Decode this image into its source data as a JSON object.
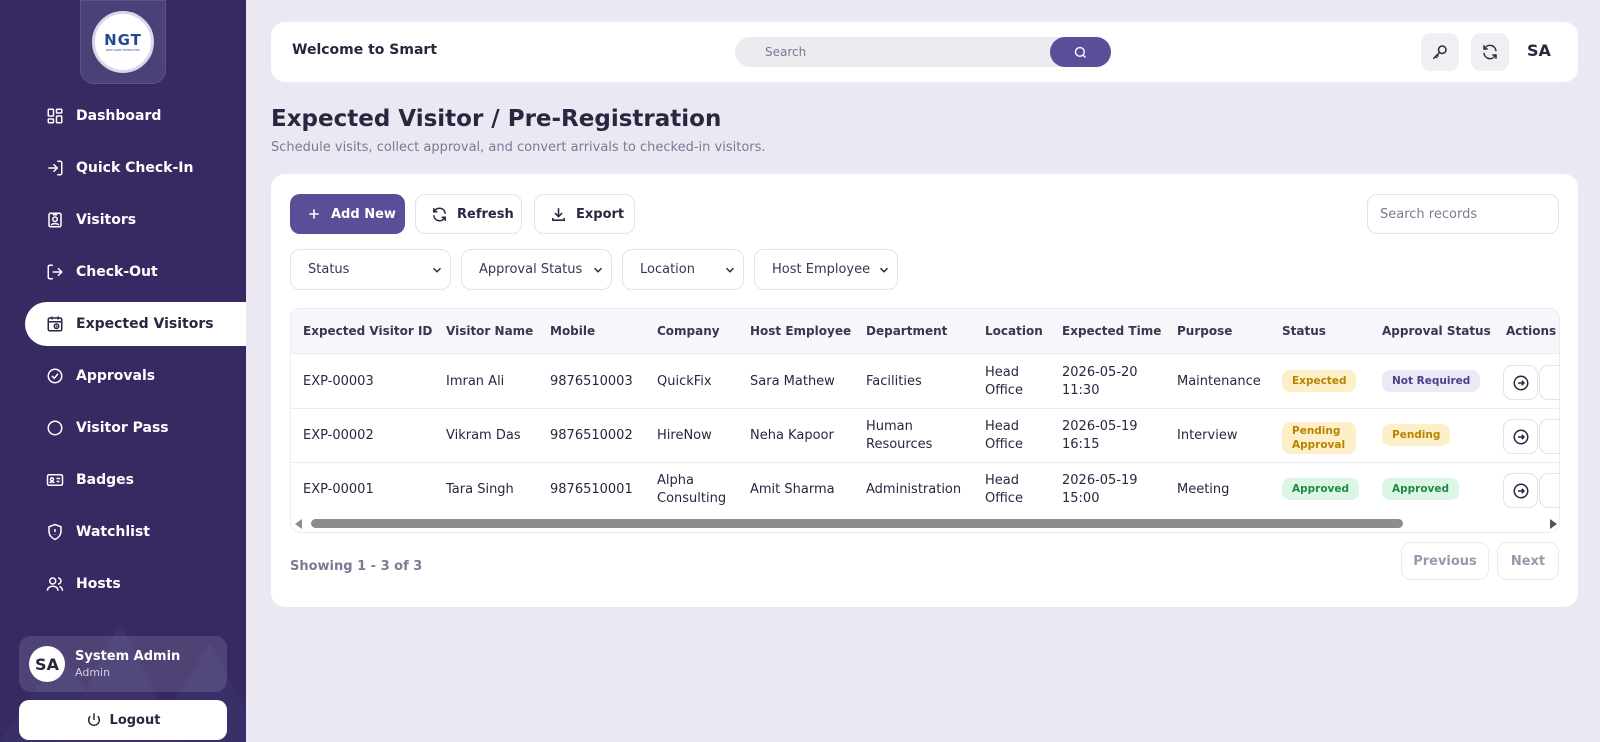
{
  "brand": {
    "logo_text": "NGT",
    "logo_sub": "NEXT-GEN TEMPLATES"
  },
  "sidebar": {
    "items": [
      {
        "label": "Dashboard",
        "icon": "dashboard-icon"
      },
      {
        "label": "Quick Check-In",
        "icon": "check-in-icon"
      },
      {
        "label": "Visitors",
        "icon": "visitor-badge-icon"
      },
      {
        "label": "Check-Out",
        "icon": "check-out-icon"
      },
      {
        "label": "Expected Visitors",
        "icon": "calendar-clock-icon",
        "active": true
      },
      {
        "label": "Approvals",
        "icon": "check-circle-icon"
      },
      {
        "label": "Visitor Pass",
        "icon": "circle-icon"
      },
      {
        "label": "Badges",
        "icon": "id-card-icon"
      },
      {
        "label": "Watchlist",
        "icon": "shield-icon"
      },
      {
        "label": "Hosts",
        "icon": "users-icon"
      }
    ],
    "user": {
      "initials": "SA",
      "name": "System Admin",
      "role": "Admin"
    },
    "logout_label": "Logout"
  },
  "header": {
    "welcome": "Welcome to Smart",
    "search_placeholder": "Search",
    "initials": "SA"
  },
  "page": {
    "title": "Expected Visitor / Pre-Registration",
    "subtitle": "Schedule visits, collect approval, and convert arrivals to checked-in visitors."
  },
  "toolbar": {
    "add_label": "Add New",
    "refresh_label": "Refresh",
    "export_label": "Export",
    "search_placeholder": "Search records"
  },
  "filters": {
    "status": "Status",
    "approval_status": "Approval Status",
    "location": "Location",
    "host_employee": "Host Employee"
  },
  "table": {
    "columns": [
      "Expected Visitor ID",
      "Visitor Name",
      "Mobile",
      "Company",
      "Host Employee",
      "Department",
      "Location",
      "Expected Time",
      "Purpose",
      "Status",
      "Approval Status",
      "Actions"
    ],
    "rows": [
      {
        "id": "EXP-00003",
        "name": "Imran Ali",
        "mobile": "9876510003",
        "company": "QuickFix",
        "host": "Sara Mathew",
        "department": "Facilities",
        "location": "Head Office",
        "time": "2026-05-20 11:30",
        "purpose": "Maintenance",
        "status": "Expected",
        "approval": "Not Required"
      },
      {
        "id": "EXP-00002",
        "name": "Vikram Das",
        "mobile": "9876510002",
        "company": "HireNow",
        "host": "Neha Kapoor",
        "department": "Human Resources",
        "location": "Head Office",
        "time": "2026-05-19 16:15",
        "purpose": "Interview",
        "status": "Pending Approval",
        "approval": "Pending"
      },
      {
        "id": "EXP-00001",
        "name": "Tara Singh",
        "mobile": "9876510001",
        "company": "Alpha Consulting",
        "host": "Amit Sharma",
        "department": "Administration",
        "location": "Head Office",
        "time": "2026-05-19 15:00",
        "purpose": "Meeting",
        "status": "Approved",
        "approval": "Approved"
      }
    ]
  },
  "pagination": {
    "showing": "Showing 1 - 3 of 3",
    "previous": "Previous",
    "next": "Next"
  },
  "colors": {
    "sidebar_bg": "#372a62",
    "accent": "#5b4d98",
    "page_bg": "#ebe8f3"
  }
}
